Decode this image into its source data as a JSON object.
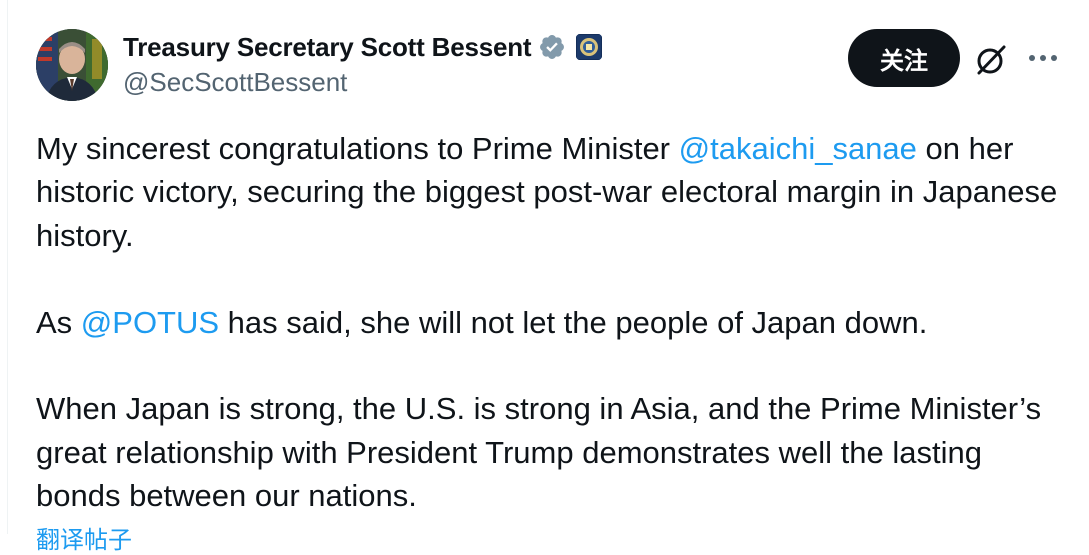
{
  "author": {
    "display_name": "Treasury Secretary Scott Bessent",
    "handle": "@SecScottBessent"
  },
  "actions": {
    "follow_label": "关注",
    "grok_icon": "grok-icon",
    "more_icon": "more-icon"
  },
  "tweet": {
    "p1_before": "My sincerest congratulations to Prime Minister ",
    "p1_mention": "@takaichi_sanae",
    "p1_after": " on her historic victory, securing the biggest post-war electoral margin in Japanese history.",
    "p2_before": "As ",
    "p2_mention": "@POTUS",
    "p2_after": " has said, she will not let the people of Japan down.",
    "p3": "When Japan is strong, the U.S. is strong in Asia, and the Prime Minister’s great relationship with President Trump demonstrates well the lasting bonds between our nations."
  },
  "translate_label": "翻译帖子",
  "colors": {
    "text": "#0f1419",
    "secondary": "#536471",
    "link": "#1d9bf0",
    "verified": "#829aab",
    "button_bg": "#0f1419"
  }
}
